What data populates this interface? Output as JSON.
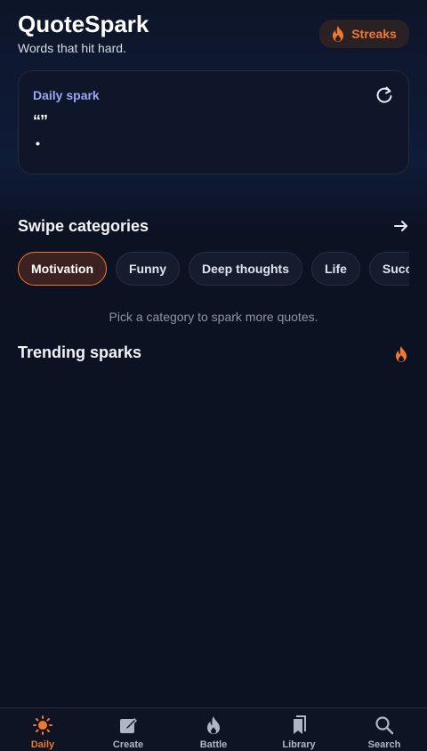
{
  "app": {
    "title": "QuoteSpark",
    "subtitle": "Words that hit hard."
  },
  "header": {
    "streaks_label": "Streaks",
    "streaks_icon": "fire-icon"
  },
  "daily_card": {
    "label": "Daily spark",
    "quote": "“”",
    "author": "•",
    "refresh_icon": "refresh-icon"
  },
  "categories": {
    "title": "Swipe categories",
    "items": [
      "Motivation",
      "Funny",
      "Deep thoughts",
      "Life",
      "Success"
    ],
    "active": "Motivation",
    "hint": "Pick a category to spark more quotes."
  },
  "trending": {
    "title": "Trending sparks"
  },
  "nav": {
    "items": [
      {
        "label": "Daily",
        "icon": "sun-icon"
      },
      {
        "label": "Create",
        "icon": "edit-icon"
      },
      {
        "label": "Battle",
        "icon": "fire-icon"
      },
      {
        "label": "Library",
        "icon": "bookmarks-icon"
      },
      {
        "label": "Search",
        "icon": "search-icon"
      }
    ],
    "active": "Daily"
  },
  "colors": {
    "accent": "#f0782f",
    "background": "#0c1222",
    "card_label": "#9aa8f2"
  }
}
